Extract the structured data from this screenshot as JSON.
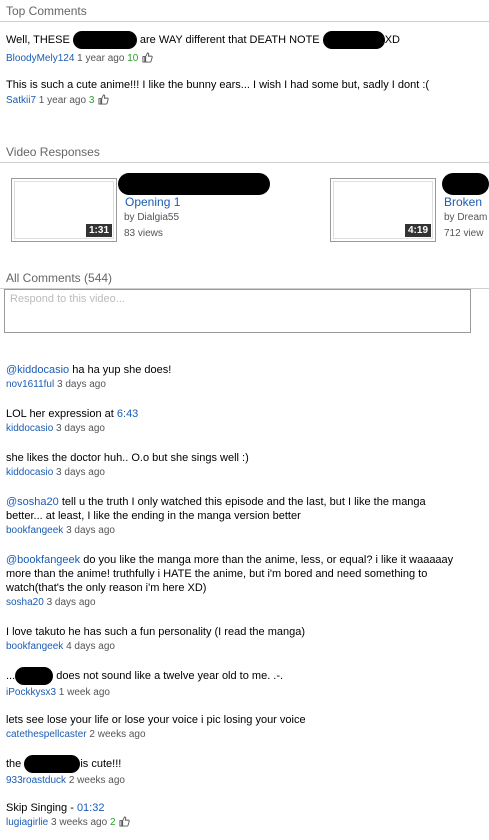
{
  "top_comments": {
    "heading": "Top Comments",
    "items": [
      {
        "text_a": "Well, THESE",
        "text_b": "are WAY different that DEATH NOTE",
        "text_c": "XD",
        "user": "BloodyMely124",
        "time": "1 year ago",
        "rating": "10"
      },
      {
        "text": "This is such a cute anime!!! I like the bunny ears... I wish I had some but, sadly I dont :(",
        "user": "Satkii7",
        "time": "1 year ago",
        "rating": "3"
      }
    ]
  },
  "video_responses": {
    "heading": "Video Responses",
    "items": [
      {
        "duration": "1:31",
        "title": "Opening 1",
        "by": "by Dialgia55",
        "views": "83 views"
      },
      {
        "duration": "4:19",
        "title": "Broken",
        "by": "by Dream",
        "views": "712 view"
      }
    ]
  },
  "all_comments": {
    "heading": "All Comments (544)",
    "placeholder": "Respond to this video...",
    "items": [
      {
        "mention": "@kiddocasio",
        "text": "ha ha yup she does!",
        "user": "nov1611ful",
        "time": "3 days ago"
      },
      {
        "text": "LOL her expression at",
        "timestamp_link": "6:43",
        "user": "kiddocasio",
        "time": "3 days ago"
      },
      {
        "text": "she likes the doctor huh.. O.o but she sings well :)",
        "user": "kiddocasio",
        "time": "3 days ago"
      },
      {
        "mention": "@sosha20",
        "text": "tell u the truth I only watched this episode and the last, but I like the manga better... at least, I like the ending in the manga version better",
        "user": "bookfangeek",
        "time": "3 days ago"
      },
      {
        "mention": "@bookfangeek",
        "text": "do you like the manga more than the anime, less, or equal? i like it waaaaay more than the anime! truthfully i HATE the anime, but i'm bored and need something to watch(that's the only reason i'm here XD)",
        "user": "sosha20",
        "time": "3 days ago"
      },
      {
        "text": "I love takuto he has such a fun personality (I read the manga)",
        "user": "bookfangeek",
        "time": "4 days ago"
      },
      {
        "text_a": "...",
        "text_b": "does not sound like a twelve year old to me. .-.",
        "user": "iPockkysx3",
        "time": "1 week ago"
      },
      {
        "text": "lets see lose your life or lose your voice i pic losing your voice",
        "user": "catethespellcaster",
        "time": "2 weeks ago"
      },
      {
        "text_a": "the",
        "text_b": "is cute!!!",
        "user": "933roastduck",
        "time": "2 weeks ago"
      },
      {
        "text": "Skip Singing -",
        "timestamp_link": "01:32",
        "user": "lugiagirlie",
        "time": "3 weeks ago",
        "rating": "2"
      }
    ]
  },
  "icons": {
    "thumb": "thumbs-up-icon"
  },
  "colors": {
    "link": "#1b5cb5",
    "rating": "#2a9d2a"
  }
}
